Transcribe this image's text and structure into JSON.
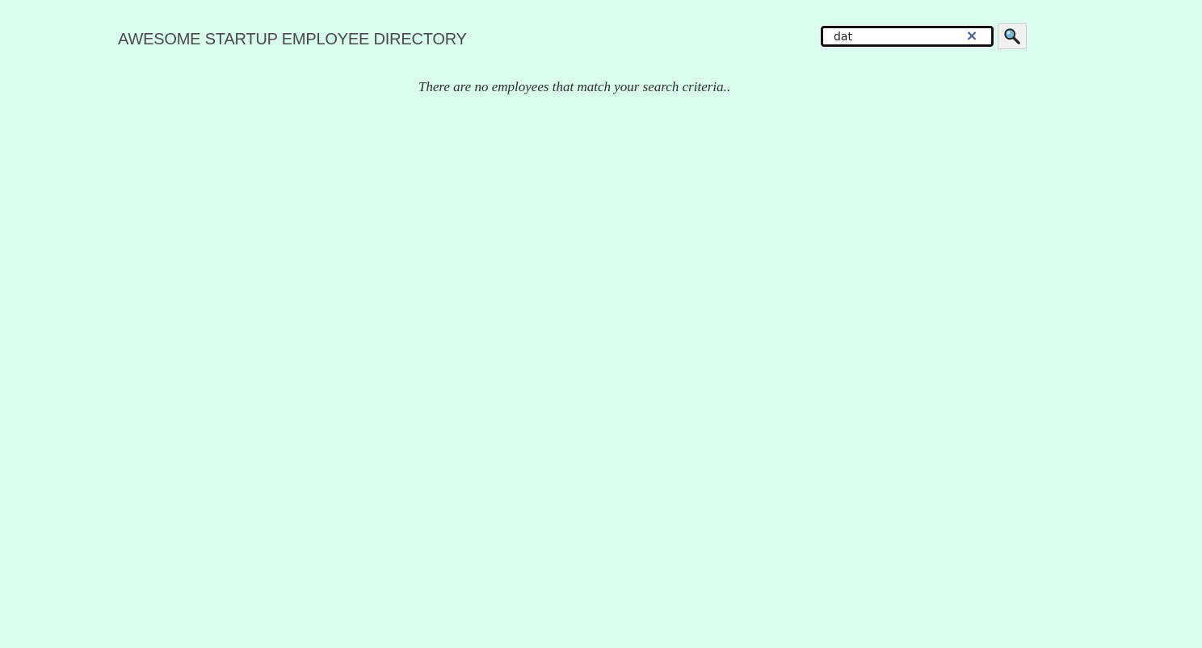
{
  "header": {
    "title": "AWESOME STARTUP EMPLOYEE DIRECTORY"
  },
  "search": {
    "value": "dat",
    "clear_icon": "close-icon",
    "button_icon": "search-icon"
  },
  "results": {
    "empty_message": "There are no employees that match your search criteria.."
  },
  "colors": {
    "background": "#d9fdee",
    "title": "#4a4a4a",
    "clear_icon": "#4b5f9b"
  }
}
